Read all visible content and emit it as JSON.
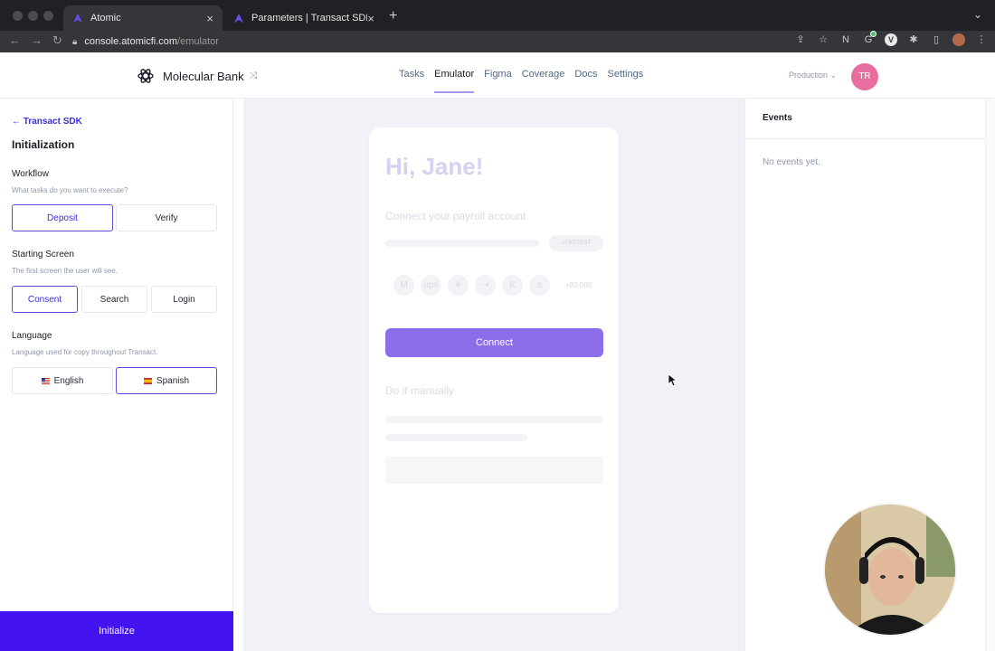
{
  "browser": {
    "tabs": [
      {
        "title": "Atomic",
        "active": true
      },
      {
        "title": "Parameters | Transact SDK Ref",
        "active": false
      }
    ],
    "url_host": "console.atomicfi.com",
    "url_path": "/emulator",
    "profile_initial": "V"
  },
  "header": {
    "brand": "Molecular Bank",
    "nav": [
      "Tasks",
      "Emulator",
      "Figma",
      "Coverage",
      "Docs",
      "Settings"
    ],
    "active_nav": "Emulator",
    "environment": "Production",
    "user_initials": "TR",
    "accent": "#a896f3"
  },
  "sidebar": {
    "back_label": "Transact SDK",
    "title": "Initialization",
    "workflow": {
      "label": "Workflow",
      "help": "What tasks do you want to execute?",
      "options": [
        "Deposit",
        "Verify"
      ],
      "selected": "Deposit"
    },
    "starting_screen": {
      "label": "Starting Screen",
      "help": "The first screen the user will see.",
      "options": [
        "Consent",
        "Search",
        "Login"
      ],
      "selected": "Consent"
    },
    "language": {
      "label": "Language",
      "help": "Language used for copy throughout Transact.",
      "options": [
        "English",
        "Spanish"
      ],
      "selected": "Spanish"
    },
    "initialize_label": "Initialize",
    "initialize_color": "#4314ef"
  },
  "emulator": {
    "greeting": "Hi, Jane!",
    "subtitle": "Connect your payroll account",
    "fastest_badge": "FASTEST",
    "employer_logos": [
      "mcdonalds-logo",
      "ups-logo",
      "walmart-logo",
      "fedex-logo",
      "kroger-logo",
      "amazon-logo"
    ],
    "logos_more": "+80,000",
    "connect_label": "Connect",
    "connect_color": "#8c6fe8",
    "manual_label": "Do it manually"
  },
  "events": {
    "title": "Events",
    "empty_text": "No events yet."
  }
}
